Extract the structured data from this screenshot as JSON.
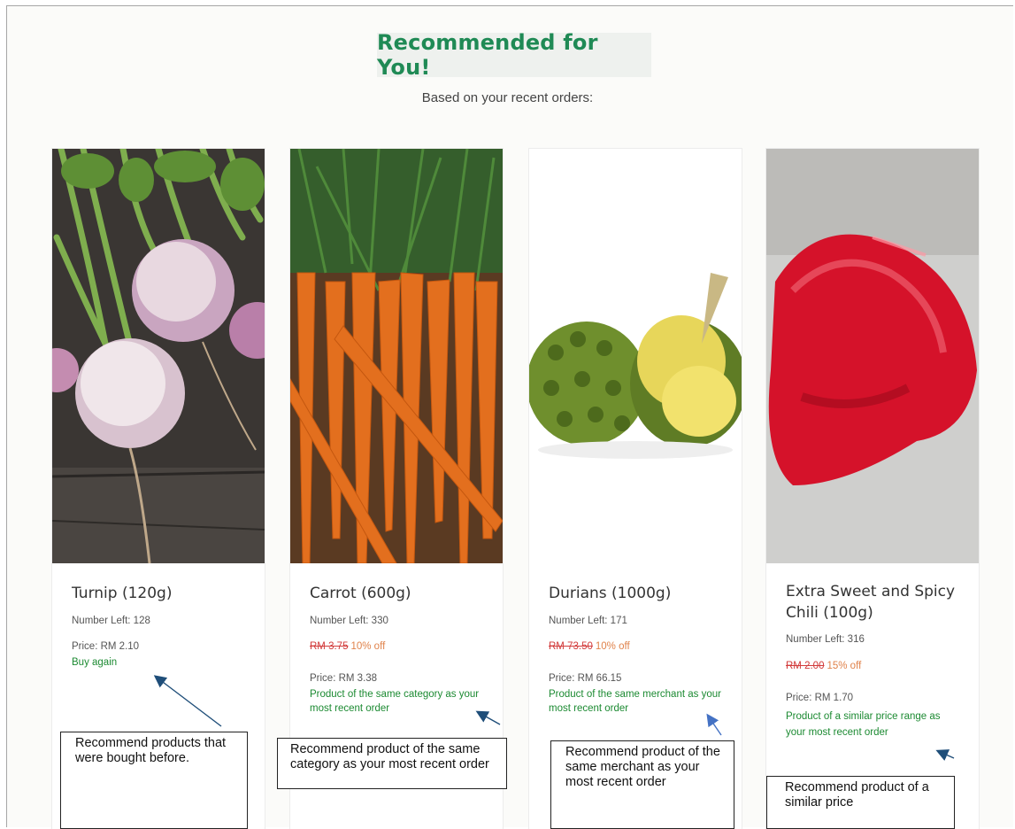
{
  "header": {
    "title": "Recommended for You!",
    "subtitle": "Based on your recent orders:"
  },
  "products": [
    {
      "name": "Turnip (120g)",
      "number_left": "Number Left: 128",
      "price": "Price: RM 2.10",
      "reason": "Buy again",
      "annotation": "Recommend products that were bought before."
    },
    {
      "name": "Carrot (600g)",
      "number_left": "Number Left: 330",
      "old_price": "RM 3.75",
      "discount": "10% off",
      "price": "Price: RM 3.38",
      "reason": "Product of the same category as your most recent order",
      "annotation": "Recommend product of the same category as your most recent order"
    },
    {
      "name": "Durians (1000g)",
      "number_left": "Number Left: 171",
      "old_price": "RM 73.50",
      "discount": "10% off",
      "price": "Price: RM 66.15",
      "reason": "Product of the same merchant as your most recent order",
      "annotation": "Recommend product of the same merchant as your most recent order"
    },
    {
      "name": "Extra Sweet and Spicy Chili (100g)",
      "number_left": "Number Left: 316",
      "old_price": "RM 2.00",
      "discount": "15% off",
      "price": "Price: RM 1.70",
      "reason": "Product of a similar price range as your most recent order",
      "annotation": "Recommend product of a similar price"
    }
  ],
  "colors": {
    "title_green": "#1f8a55",
    "reason_green": "#1c8a32",
    "old_price_red": "#d23b3b",
    "discount_orange": "#e0824a",
    "arrow_blue": "#1f4e79"
  }
}
